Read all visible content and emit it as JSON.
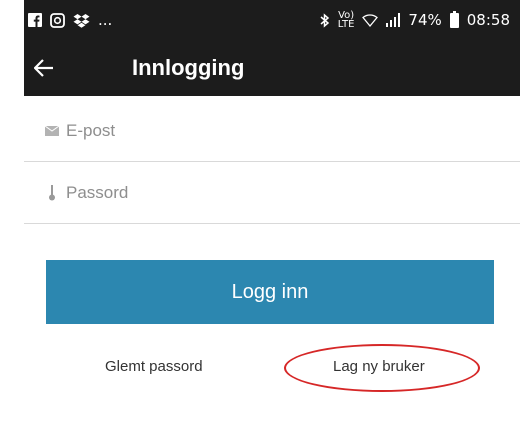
{
  "status_bar": {
    "left_icons": [
      "facebook-icon",
      "instagram-icon",
      "dropbox-icon"
    ],
    "more": "...",
    "battery": "74%",
    "time": "08:58",
    "volte_top": "Vo)",
    "volte_bottom": "LTE"
  },
  "app_bar": {
    "title": "Innlogging"
  },
  "form": {
    "email_placeholder": "E-post",
    "password_placeholder": "Passord",
    "login_label": "Logg inn"
  },
  "links": {
    "forgot_password": "Glemt passord",
    "create_user": "Lag ny bruker"
  },
  "colors": {
    "bar": "#1c1c1c",
    "button": "#2c87b0",
    "highlight": "#d62727"
  }
}
